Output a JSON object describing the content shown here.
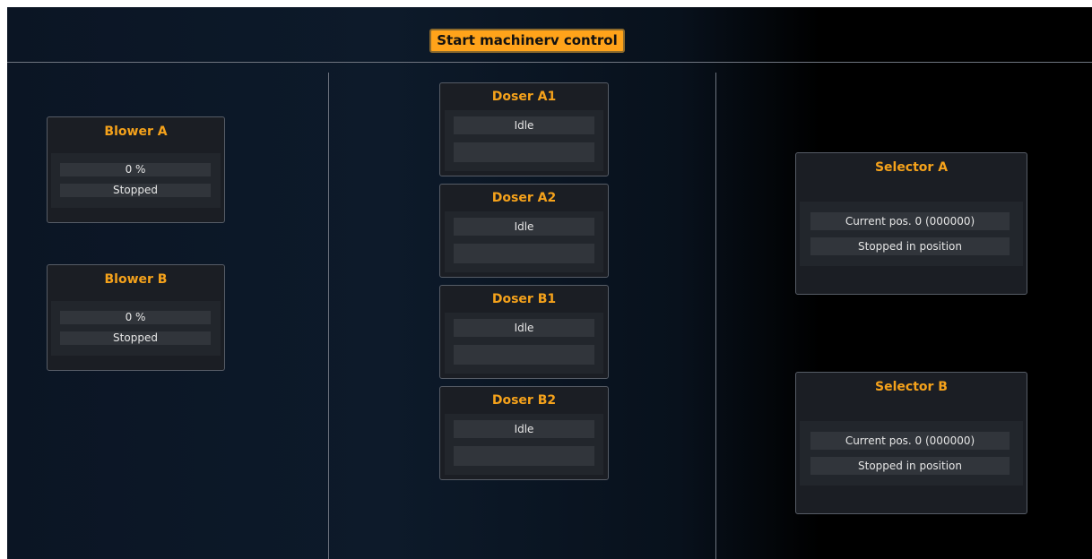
{
  "toolbar": {
    "start_label": "Start machinerv control"
  },
  "blowers": [
    {
      "title": "Blower A",
      "speed": "0 %",
      "status": "Stopped"
    },
    {
      "title": "Blower B",
      "speed": "0 %",
      "status": "Stopped"
    }
  ],
  "dosers": [
    {
      "title": "Doser A1",
      "status": "Idle",
      "detail": ""
    },
    {
      "title": "Doser A2",
      "status": "Idle",
      "detail": ""
    },
    {
      "title": "Doser B1",
      "status": "Idle",
      "detail": ""
    },
    {
      "title": "Doser B2",
      "status": "Idle",
      "detail": ""
    }
  ],
  "selectors": [
    {
      "title": "Selector A",
      "position": "Current pos. 0 (000000)",
      "status": "Stopped in position"
    },
    {
      "title": "Selector B",
      "position": "Current pos. 0 (000000)",
      "status": "Stopped in position"
    }
  ],
  "colors": {
    "accent": "#f5a21b",
    "button": "#ffa31a",
    "panel_bg": "#1b1e24",
    "field_bg": "#31353b"
  }
}
